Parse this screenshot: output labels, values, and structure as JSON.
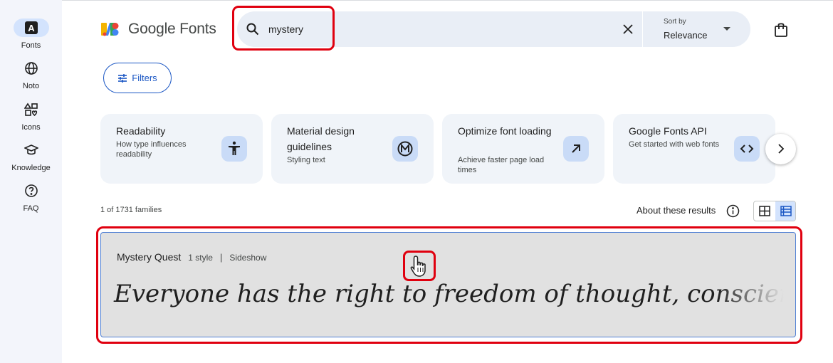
{
  "rail": {
    "items": [
      {
        "label": "Fonts",
        "icon": "font-A-icon",
        "active": true
      },
      {
        "label": "Noto",
        "icon": "globe-icon"
      },
      {
        "label": "Icons",
        "icon": "shapes-icon"
      },
      {
        "label": "Knowledge",
        "icon": "graduation-cap-icon"
      },
      {
        "label": "FAQ",
        "icon": "help-circle-icon"
      }
    ]
  },
  "header": {
    "logo_text": "Google Fonts",
    "search": {
      "value": "mystery"
    },
    "sort": {
      "label": "Sort by",
      "value": "Relevance"
    }
  },
  "filters_label": "Filters",
  "cards": [
    {
      "title": "Readability",
      "subtitle": "How type influences readability",
      "icon": "accessibility-icon"
    },
    {
      "title": "Material design guidelines",
      "subtitle": "Styling text",
      "icon": "material-logo-icon"
    },
    {
      "title": "Optimize font loading",
      "subtitle": "Achieve faster page load times",
      "icon": "arrow-up-right-icon"
    },
    {
      "title": "Google Fonts API",
      "subtitle": "Get started with web fonts",
      "icon": "code-icon"
    }
  ],
  "results": {
    "count_text": "1 of 1731 families",
    "about_text": "About these results"
  },
  "result": {
    "name": "Mystery Quest",
    "styles": "1 style",
    "separator": "|",
    "designer": "Sideshow",
    "preview_text": "Everyone has the right to freedom of thought, conscience and"
  },
  "colors": {
    "accent": "#1b57c4",
    "highlight": "#e0000f",
    "rail_bg": "#f3f5fb",
    "search_bg": "#e9eef6"
  }
}
